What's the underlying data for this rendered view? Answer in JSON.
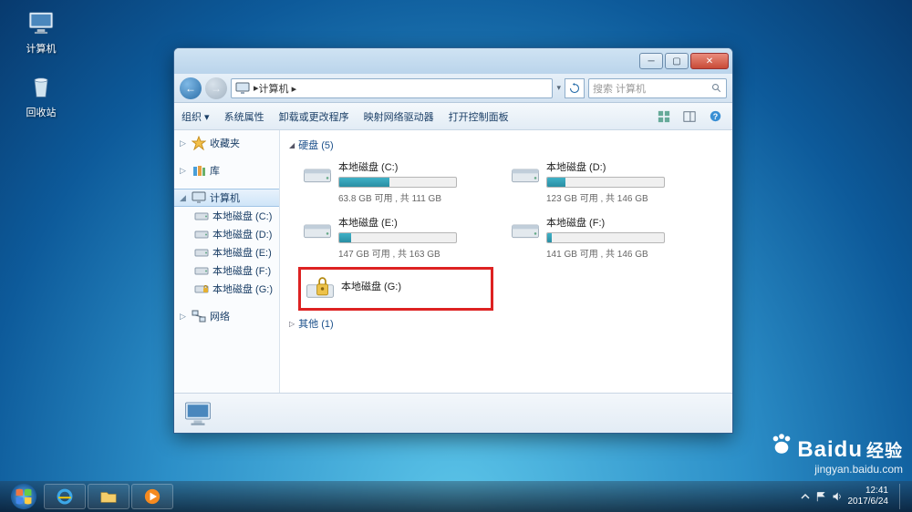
{
  "desktop": {
    "icons": [
      {
        "label": "计算机",
        "type": "computer"
      },
      {
        "label": "回收站",
        "type": "recycle"
      }
    ]
  },
  "window": {
    "breadcrumb": "计算机 ▸",
    "search_placeholder": "搜索 计算机",
    "toolbar": {
      "organize": "组织 ▾",
      "items": [
        "系统属性",
        "卸载或更改程序",
        "映射网络驱动器",
        "打开控制面板"
      ]
    },
    "sidebar": {
      "favorites": "收藏夹",
      "libraries": "库",
      "computer": "计算机",
      "network": "网络",
      "drives": [
        "本地磁盘 (C:)",
        "本地磁盘 (D:)",
        "本地磁盘 (E:)",
        "本地磁盘 (F:)",
        "本地磁盘 (G:)"
      ]
    },
    "groups": {
      "hdd": "硬盘 (5)",
      "other": "其他 (1)"
    },
    "drives": [
      {
        "name": "本地磁盘 (C:)",
        "free": "63.8 GB 可用 , 共 111 GB",
        "fill": 43
      },
      {
        "name": "本地磁盘 (D:)",
        "free": "123 GB 可用 , 共 146 GB",
        "fill": 16
      },
      {
        "name": "本地磁盘 (E:)",
        "free": "147 GB 可用 , 共 163 GB",
        "fill": 10
      },
      {
        "name": "本地磁盘 (F:)",
        "free": "141 GB 可用 , 共 146 GB",
        "fill": 4
      },
      {
        "name": "本地磁盘 (G:)",
        "locked": true
      }
    ]
  },
  "taskbar": {
    "time": "12:41",
    "date": "2017/6/24"
  },
  "watermark": {
    "brand": "Baidu",
    "sub": "经验",
    "url": "jingyan.baidu.com"
  }
}
